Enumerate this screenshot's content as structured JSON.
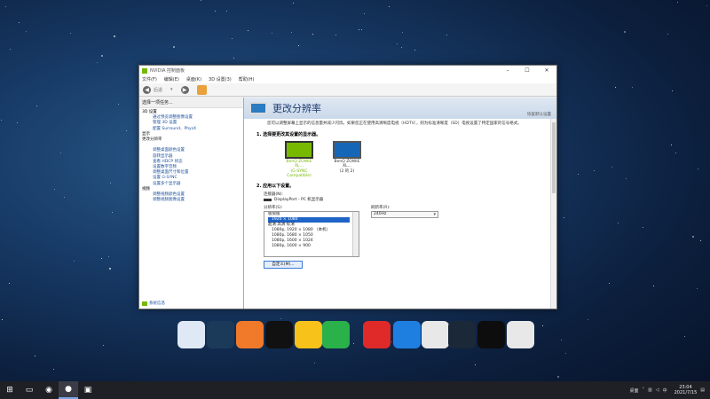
{
  "window": {
    "title": "NVIDIA 控制面板",
    "menus": [
      "文件(F)",
      "编辑(E)",
      "桌面(K)",
      "3D 设置(3)",
      "帮助(H)"
    ],
    "back_label": "后退",
    "forward_label": ""
  },
  "tree": {
    "header": "选择一项任务...",
    "items": [
      {
        "label": "3D 设置",
        "kind": "cat"
      },
      {
        "label": "通过预览调整图像设置",
        "kind": "item"
      },
      {
        "label": "管理 3D 设置",
        "kind": "item"
      },
      {
        "label": "配置 Surround、PhysX",
        "kind": "item"
      },
      {
        "label": "显示",
        "kind": "cat"
      },
      {
        "label": "更改分辨率",
        "kind": "sel"
      },
      {
        "label": "调整桌面颜色设置",
        "kind": "item"
      },
      {
        "label": "旋转显示器",
        "kind": "item"
      },
      {
        "label": "查看 HDCP 状态",
        "kind": "item"
      },
      {
        "label": "设置数字音频",
        "kind": "item"
      },
      {
        "label": "调整桌面尺寸和位置",
        "kind": "item"
      },
      {
        "label": "设置 G-SYNC",
        "kind": "item"
      },
      {
        "label": "设置多个显示器",
        "kind": "item"
      },
      {
        "label": "视频",
        "kind": "cat"
      },
      {
        "label": "调整视频颜色设置",
        "kind": "item"
      },
      {
        "label": "调整视频图像设置",
        "kind": "item"
      }
    ],
    "system_info": "系统信息"
  },
  "panel": {
    "title": "更改分辨率",
    "restore": "恢复默认设置",
    "description": "您可以调整屏幕上显示的信息量并减少闪烁。如果您正在使用高清晰度电视（HDTV），则为标准清晰度（SD）电视设置了特定国家的信号格式。",
    "section1": "1. 选择要更改其设置的显示器。",
    "monitors": [
      {
        "line1": "BenQ ZOWIE XL...",
        "line2": "(G-SYNC Compatible)"
      },
      {
        "line1": "BenQ ZOWIE XL...",
        "line2": "(2 的 2)"
      }
    ],
    "section2": "2. 应用以下设置。",
    "connector_label": "连接器(N):",
    "connector_value": "DisplayPort - PC 机显示器",
    "resolution_label": "分辨率(S):",
    "refresh_label": "刷新率(R):",
    "refresh_value": "240Hz",
    "resolution_list": [
      {
        "text": "极限版",
        "kind": "group"
      },
      {
        "text": "1920 × 1080",
        "kind": "sel"
      },
      {
        "text": "超清   高清   标清",
        "kind": "group"
      },
      {
        "text": "1080p, 1920 × 1080 （本机）",
        "kind": "ind"
      },
      {
        "text": "1080p, 1680 × 1050",
        "kind": "ind"
      },
      {
        "text": "1080p, 1600 × 1024",
        "kind": "ind"
      },
      {
        "text": "1080p, 1600 × 900",
        "kind": "ind"
      }
    ],
    "customize_button": "自定义(M)..."
  },
  "dock": {
    "icons": [
      {
        "name": "recycle-bin-icon",
        "color": "#dfe9f5"
      },
      {
        "name": "app-circle-icon",
        "color": "#1b3a5a"
      },
      {
        "name": "orange-circle-icon",
        "color": "#f07a2a"
      },
      {
        "name": "qq-icon",
        "color": "#111111"
      },
      {
        "name": "tim-icon",
        "color": "#f7c21a"
      },
      {
        "name": "wechat-icon",
        "color": "#2ab14a"
      },
      {
        "name": "netease-music-icon",
        "color": "#e02a2a"
      },
      {
        "name": "xunlei-icon",
        "color": "#1e7fe0"
      },
      {
        "name": "document-icon",
        "color": "#e8e8e8"
      },
      {
        "name": "steam-icon",
        "color": "#1b2838"
      },
      {
        "name": "capcut-icon",
        "color": "#0d0d0d"
      },
      {
        "name": "document2-icon",
        "color": "#e8e8e8"
      }
    ]
  },
  "taskbar": {
    "tray_label": "桌面",
    "time": "23:04",
    "date": "2021/7/15"
  }
}
